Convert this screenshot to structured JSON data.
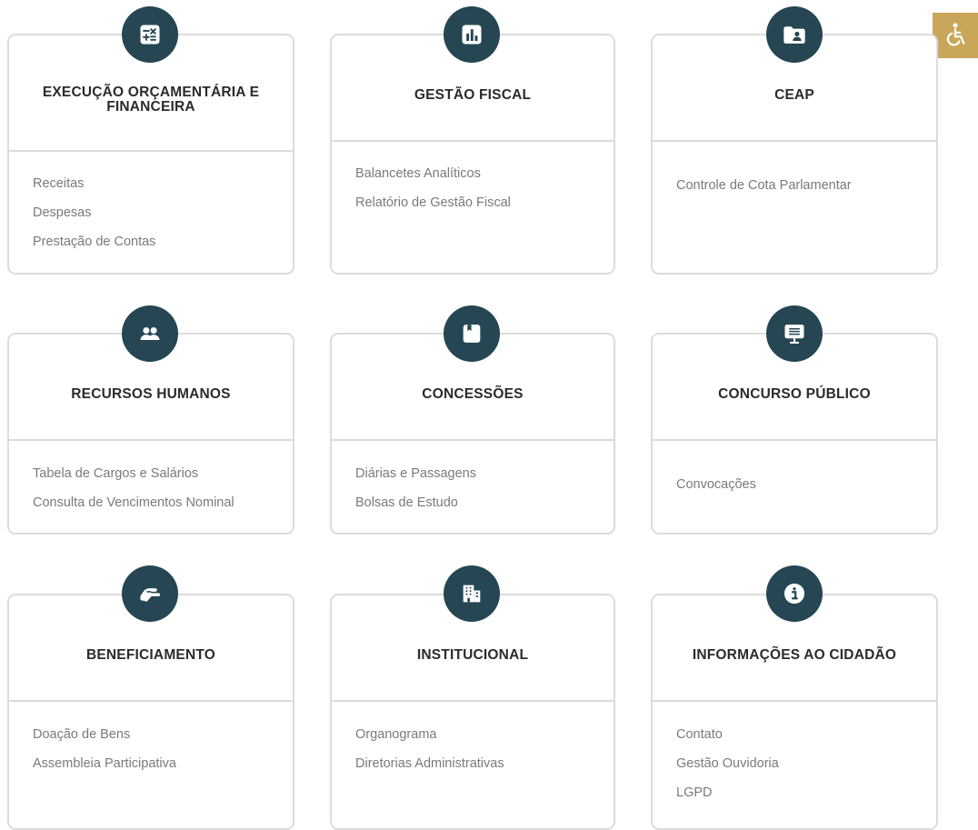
{
  "accessibility": {
    "icon": "wheelchair-icon",
    "color": "#c8a75a"
  },
  "colors": {
    "badge": "#254652",
    "title": "#2b2b2b",
    "link": "#7a7a7a",
    "border": "#dcdcdc"
  },
  "cards": [
    {
      "title": "EXECUÇÃO ORÇAMENTÁRIA E FINANCEIRA",
      "icon": "calculator-icon",
      "links": [
        "Receitas",
        "Despesas",
        "Prestação de Contas"
      ]
    },
    {
      "title": "GESTÃO FISCAL",
      "icon": "bar-chart-icon",
      "links": [
        "Balancetes Analíticos",
        "Relatório de Gestão Fiscal"
      ]
    },
    {
      "title": "CEAP",
      "icon": "folder-user-icon",
      "links": [
        "Controle de Cota Parlamentar"
      ]
    },
    {
      "title": "RECURSOS HUMANOS",
      "icon": "users-icon",
      "links": [
        "Tabela de Cargos e Salários",
        "Consulta de Vencimentos Nominal"
      ]
    },
    {
      "title": "CONCESSÕES",
      "icon": "book-icon",
      "links": [
        "Diárias e Passagens",
        "Bolsas de Estudo"
      ]
    },
    {
      "title": "CONCURSO PÚBLICO",
      "icon": "presentation-icon",
      "links": [
        "Convocações"
      ]
    },
    {
      "title": "BENEFICIAMENTO",
      "icon": "handshake-icon",
      "links": [
        "Doação de Bens",
        "Assembleia Participativa"
      ]
    },
    {
      "title": "INSTITUCIONAL",
      "icon": "building-icon",
      "links": [
        "Organograma",
        "Diretorias Administrativas"
      ]
    },
    {
      "title": "INFORMAÇÕES AO CIDADÃO",
      "icon": "info-icon",
      "links": [
        "Contato",
        "Gestão Ouvidoria",
        "LGPD"
      ]
    }
  ]
}
